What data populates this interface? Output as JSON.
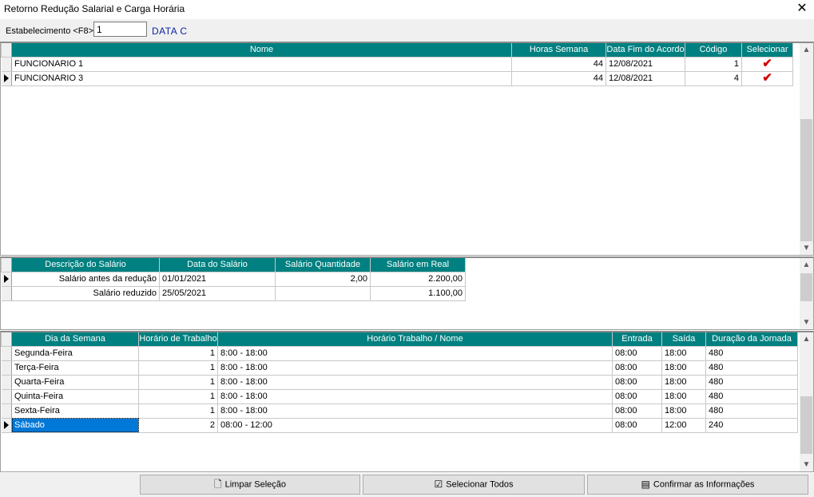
{
  "window": {
    "title": "Retorno Redução Salarial e Carga Horária",
    "close_glyph": "✕"
  },
  "toolbar": {
    "estab_label": "Estabelecimento <F8>",
    "estab_value": "1",
    "estab_name": "DATA C"
  },
  "employees": {
    "columns": [
      "Nome",
      "Horas Semana",
      "Data Fim do Acordo",
      "Código",
      "Selecionar"
    ],
    "rows": [
      {
        "nome": "FUNCIONARIO 1",
        "horas": "44",
        "data_fim": "12/08/2021",
        "codigo": "1",
        "selecionar": "✔"
      },
      {
        "nome": "FUNCIONARIO 3",
        "horas": "44",
        "data_fim": "12/08/2021",
        "codigo": "4",
        "selecionar": "✔"
      }
    ]
  },
  "salary": {
    "columns": [
      "Descrição do Salário",
      "Data do Salário",
      "Salário Quantidade",
      "Salário em Real"
    ],
    "rows": [
      {
        "descricao": "Salário antes da redução",
        "data": "01/01/2021",
        "quantidade": "2,00",
        "real": "2.200,00"
      },
      {
        "descricao": "Salário reduzido",
        "data": "25/05/2021",
        "quantidade": "",
        "real": "1.100,00"
      }
    ]
  },
  "schedule": {
    "columns": [
      "Dia da Semana",
      "Horário de Trabalho",
      "Horário Trabalho / Nome",
      "Entrada",
      "Saída",
      "Duração da Jornada"
    ],
    "rows": [
      {
        "dia": "Segunda-Feira",
        "horario": "1",
        "nome": "8:00 - 18:00",
        "entrada": "08:00",
        "saida": "18:00",
        "duracao": "480"
      },
      {
        "dia": "Terça-Feira",
        "horario": "1",
        "nome": "8:00 - 18:00",
        "entrada": "08:00",
        "saida": "18:00",
        "duracao": "480"
      },
      {
        "dia": "Quarta-Feira",
        "horario": "1",
        "nome": "8:00 - 18:00",
        "entrada": "08:00",
        "saida": "18:00",
        "duracao": "480"
      },
      {
        "dia": "Quinta-Feira",
        "horario": "1",
        "nome": "8:00 - 18:00",
        "entrada": "08:00",
        "saida": "18:00",
        "duracao": "480"
      },
      {
        "dia": "Sexta-Feira",
        "horario": "1",
        "nome": "8:00 - 18:00",
        "entrada": "08:00",
        "saida": "18:00",
        "duracao": "480"
      },
      {
        "dia": "Sábado",
        "horario": "2",
        "nome": "08:00 - 12:00",
        "entrada": "08:00",
        "saida": "12:00",
        "duracao": "240"
      }
    ]
  },
  "buttons": {
    "limpar": "Limpar Seleção",
    "selecionar_todos": "Selecionar Todos",
    "confirmar": "Confirmar as Informações"
  },
  "icons": {
    "page": "🗋",
    "checklist": "☑",
    "report": "▤",
    "scroll_up": "▲",
    "scroll_down": "▼"
  },
  "colors": {
    "header_bg": "#008080",
    "selection": "#0078d7",
    "check": "#d10000",
    "estab_name": "#0a24a8"
  }
}
